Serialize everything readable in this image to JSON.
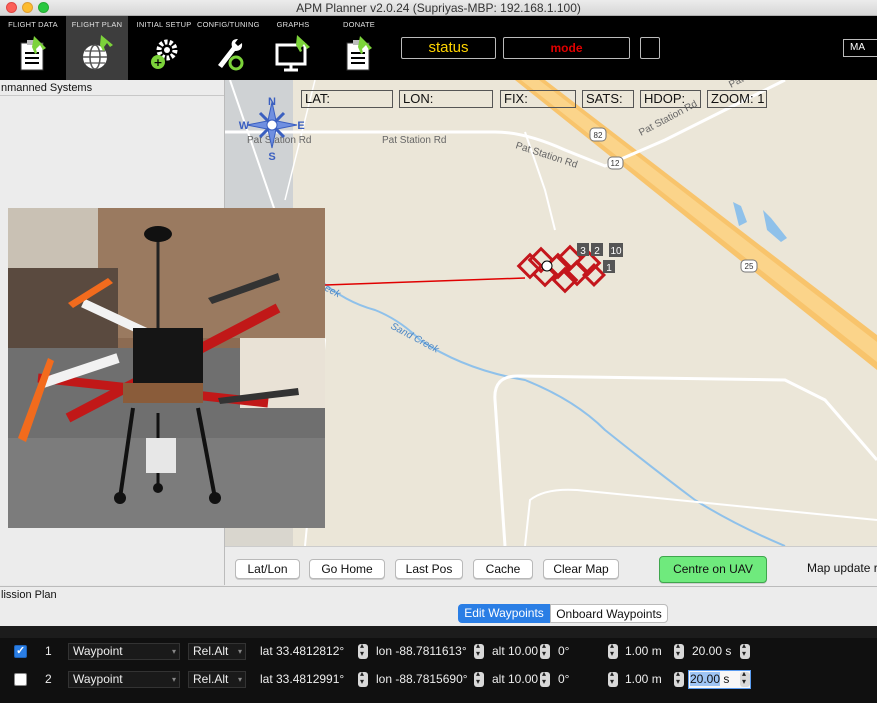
{
  "window": {
    "title": "APM Planner v2.0.24 (Supriyas-MBP: 192.168.1.100)"
  },
  "toolbar": {
    "buttons": [
      {
        "label": "FLIGHT DATA",
        "icon": "clipboard-plane-icon"
      },
      {
        "label": "FLIGHT PLAN",
        "icon": "globe-plane-icon",
        "active": true
      },
      {
        "label": "INITIAL SETUP",
        "icon": "gears-icon"
      },
      {
        "label": "CONFIG/TUNING",
        "icon": "wrench-icon"
      },
      {
        "label": "GRAPHS",
        "icon": "monitor-plane-icon"
      },
      {
        "label": "DONATE",
        "icon": "clipboard-plane-icon"
      }
    ],
    "status": "status",
    "mode": "mode",
    "right_box": "MA"
  },
  "left_panel": {
    "header": "nmanned Systems"
  },
  "map": {
    "hud": {
      "lat": "LAT:",
      "lon": "LON:",
      "fix": "FIX:",
      "sats": "SATS:",
      "hdop": "HDOP:",
      "zoom": "ZOOM: 1"
    },
    "compass": {
      "n": "N",
      "s": "S",
      "w": "W",
      "e": "E"
    },
    "labels": {
      "road_pat_station_1": "Pat Station Rd",
      "road_pat_station_2": "Pat Station Rd",
      "road_pat_station_3": "Pat Station Rd",
      "road_pat_station_4": "Pat Station Rd",
      "road_pat_top": "Pat",
      "shield_82": "82",
      "shield_12": "12",
      "shield_25": "25",
      "creek_1": "Sand Creek",
      "creek_2": "eek",
      "wp_10": "10",
      "wp_1": "1",
      "wp_3": "3",
      "wp_2": "2"
    },
    "colors": {
      "background": "#ebe6d8",
      "highway": "#f8c46c",
      "creek": "#8fc1ea",
      "track": "#e00000",
      "waypoint": "#c4161c"
    }
  },
  "mapbar": {
    "buttons": [
      "Lat/Lon",
      "Go Home",
      "Last Pos",
      "Cache",
      "Clear Map"
    ],
    "centre": "Centre on UAV",
    "map_update": "Map update ra"
  },
  "mission": {
    "header": "lission Plan",
    "tabs": [
      "Edit Waypoints",
      "Onboard Waypoints"
    ],
    "rows": [
      {
        "checked": true,
        "num": "1",
        "type": "Waypoint",
        "frame": "Rel.Alt",
        "lat": "lat 33.4812812°",
        "lon": "lon -88.7811613°",
        "alt": "alt 10.00",
        "heading": "0°",
        "radius": "1.00 m",
        "delay_value": "20.00 s",
        "delay_selected": ""
      },
      {
        "checked": false,
        "num": "2",
        "type": "Waypoint",
        "frame": "Rel.Alt",
        "lat": "lat 33.4812991°",
        "lon": "lon -88.7815690°",
        "alt": "alt 10.00",
        "heading": "0°",
        "radius": "1.00 m",
        "delay_value": "",
        "delay_selected": "20.00",
        "delay_unit": "s"
      }
    ]
  }
}
